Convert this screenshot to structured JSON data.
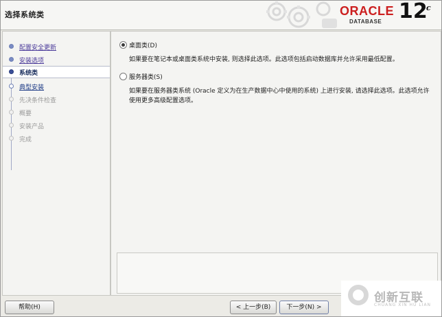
{
  "header": {
    "title": "选择系统类",
    "brand": {
      "oracle": "ORACLE",
      "registered": "®",
      "database": "DATABASE",
      "version": "12",
      "version_suffix": "c"
    }
  },
  "sidebar": {
    "steps": [
      {
        "label": "配置安全更新",
        "state": "done"
      },
      {
        "label": "安装选项",
        "state": "done"
      },
      {
        "label": "系统类",
        "state": "active"
      },
      {
        "label": "典型安装",
        "state": "link"
      },
      {
        "label": "先决条件检查",
        "state": "pending"
      },
      {
        "label": "概要",
        "state": "pending"
      },
      {
        "label": "安装产品",
        "state": "pending"
      },
      {
        "label": "完成",
        "state": "pending"
      }
    ]
  },
  "options": [
    {
      "label": "桌面类(D)",
      "selected": true,
      "description": "如果要在笔记本或桌面类系统中安装, 则选择此选项。此选项包括启动数据库并允许采用最低配置。"
    },
    {
      "label": "服务器类(S)",
      "selected": false,
      "description": "如果要在服务器类系统 (Oracle 定义为在生产数据中心中使用的系统) 上进行安装, 请选择此选项。此选项允许使用更多高级配置选项。"
    }
  ],
  "footer": {
    "help_label": "帮助(H)",
    "back_label": "< 上一步(B)",
    "next_label": "下一步(N) >"
  },
  "watermark": {
    "cn": "创新互联",
    "en": "CHUANG XIN HU LIAN"
  },
  "colors": {
    "brand_red": "#cc1f1f",
    "active_step": "#1b2f5e",
    "done_step": "#4a3a9a",
    "pending_step": "#9a9a9a"
  }
}
